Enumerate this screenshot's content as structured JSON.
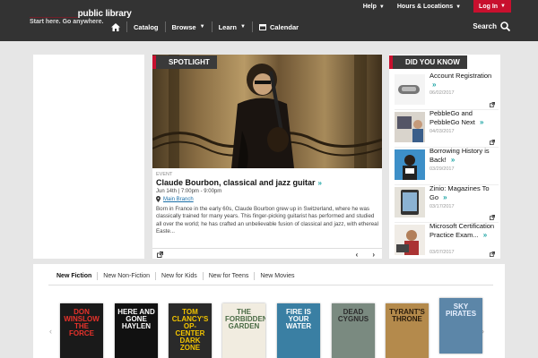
{
  "header": {
    "logo_prefix": "__________",
    "logo_suffix": "public library",
    "tagline": "Start here. Go anywhere.",
    "top_links": [
      {
        "label": "Help"
      },
      {
        "label": "Hours & Locations"
      }
    ],
    "login_label": "Log In",
    "nav": [
      {
        "label": "Catalog"
      },
      {
        "label": "Browse"
      },
      {
        "label": "Learn"
      },
      {
        "label": "Calendar"
      }
    ],
    "search_label": "Search"
  },
  "spotlight": {
    "tag": "SPOTLIGHT",
    "event_label": "EVENT",
    "title": "Claude Bourbon, classical and jazz guitar",
    "time": "Jun 14th | 7:00pm - 9:00pm",
    "location": "Main Branch",
    "description": "Born in France in the early 60s, Claude Bourbon grew up in Switzerland, where he was classically trained for many years. This finger-picking guitarist has performed and studied all over the world; he has crafted an unbelievable fusion of classical and jazz, with ethereal Easte...",
    "prev": "‹",
    "next": "›"
  },
  "did_you_know": {
    "tag": "DID YOU KNOW",
    "items": [
      {
        "title": "Account Registration",
        "date": "06/02/2017"
      },
      {
        "title": "PebbleGo and PebbleGo Next",
        "date": "04/03/2017"
      },
      {
        "title": "Borrowing History is Back!",
        "date": "03/29/2017"
      },
      {
        "title": "Zinio: Magazines To Go",
        "date": "03/17/2017"
      },
      {
        "title": "Microsoft Certification Practice Exam...",
        "date": "03/07/2017"
      }
    ]
  },
  "books": {
    "tabs": [
      {
        "label": "New Fiction"
      },
      {
        "label": "New Non-Fiction"
      },
      {
        "label": "New for Kids"
      },
      {
        "label": "New for Teens"
      },
      {
        "label": "New Movies"
      }
    ],
    "covers": [
      {
        "text": "DON WINSLOW THE FORCE",
        "bg": "#1a1a1a",
        "fg": "#e8322b"
      },
      {
        "text": "HERE AND GONE HAYLEN",
        "bg": "#111111",
        "fg": "#ffffff"
      },
      {
        "text": "TOM CLANCY'S OP-CENTER DARK ZONE",
        "bg": "#2a2a2a",
        "fg": "#f2c400"
      },
      {
        "text": "THE FORBIDDEN GARDEN",
        "bg": "#f1ece0",
        "fg": "#4a6b45"
      },
      {
        "text": "FIRE IS YOUR WATER",
        "bg": "#3a7fa3",
        "fg": "#ffffff"
      },
      {
        "text": "DEAD CYGNUS",
        "bg": "#7a8a80",
        "fg": "#2c2c2c"
      },
      {
        "text": "TYRANT'S THRONE",
        "bg": "#b48a4c",
        "fg": "#2a1c0c"
      },
      {
        "text": "SKY PIRATES",
        "bg": "#5c86a8",
        "fg": "#e8f0ff"
      }
    ]
  }
}
